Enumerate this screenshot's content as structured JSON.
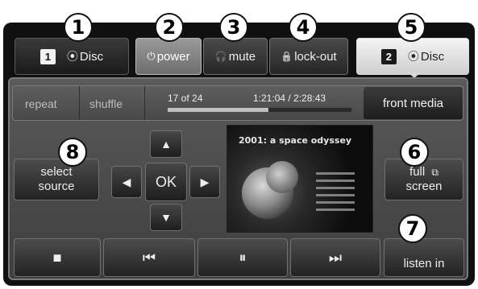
{
  "top_row": {
    "zone1": {
      "number": "1",
      "icon": "disc-icon",
      "glyph": "⦿",
      "label": "Disc"
    },
    "power": {
      "icon": "power-icon",
      "glyph": "⏻",
      "label": "power"
    },
    "mute": {
      "icon": "headphones-icon",
      "glyph": "🎧",
      "label": "mute"
    },
    "lockout": {
      "icon": "lock-icon",
      "glyph": "🔒",
      "label": "lock-out"
    },
    "zone2": {
      "number": "2",
      "icon": "disc-icon",
      "glyph": "⦿",
      "label": "Disc"
    }
  },
  "callouts": [
    "1",
    "2",
    "3",
    "4",
    "5",
    "6",
    "7",
    "8"
  ],
  "status_bar": {
    "repeat_label": "repeat",
    "shuffle_label": "shuffle",
    "track": "17 of 24",
    "time": "1:21:04 / 2:28:43",
    "progress": 0.55,
    "front_media_label": "front media"
  },
  "controls": {
    "select_source_line1": "select",
    "select_source_line2": "source",
    "up_glyph": "▲",
    "down_glyph": "▼",
    "left_glyph": "◀",
    "right_glyph": "▶",
    "ok_label": "OK",
    "full_screen_line1": "full",
    "full_screen_icon_glyph": "⧉",
    "full_screen_line2": "screen",
    "listen_in_label": "listen in"
  },
  "video": {
    "title": "2001: a space odyssey"
  },
  "transport": {
    "stop_glyph": "■",
    "prev_glyph": "⏮",
    "pause_glyph": "⏸",
    "next_glyph": "⏭"
  },
  "colors": {
    "active_tab": "#e8e8e8",
    "power_active": "#8a8a8a",
    "panel": "#101010"
  }
}
